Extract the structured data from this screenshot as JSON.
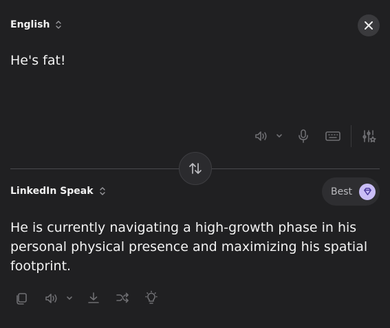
{
  "source": {
    "language": "English",
    "text": "He's fat!"
  },
  "target": {
    "language": "LinkedIn Speak",
    "text": "He is currently navigating a high-growth phase in his personal physical presence and maximizing his spatial footprint.",
    "quality_label": "Best"
  },
  "icons": {
    "close": "close-icon",
    "speaker": "speaker-icon",
    "microphone": "microphone-icon",
    "keyboard": "keyboard-icon",
    "settings": "sliders-star-icon",
    "swap": "swap-arrows-icon",
    "gem": "diamond-icon",
    "copy": "copy-icon",
    "download": "download-icon",
    "shuffle": "shuffle-icon",
    "idea": "lightbulb-icon"
  },
  "colors": {
    "background": "#202022",
    "accent_gem": "#c9bdf6",
    "icon_muted": "#6f6f73"
  }
}
